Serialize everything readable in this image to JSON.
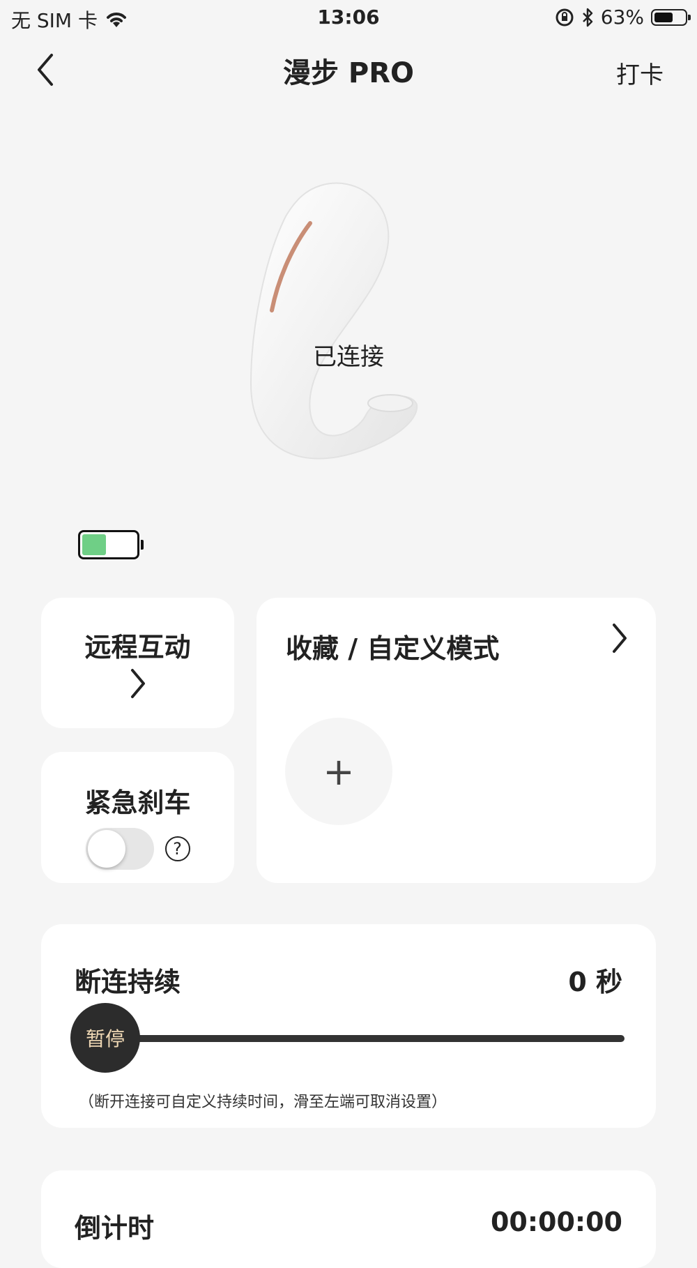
{
  "status_bar": {
    "carrier": "无 SIM 卡",
    "time": "13:06",
    "battery_percent": "63%",
    "battery_level": 0.63,
    "icons": [
      "wifi-icon",
      "orientation-lock-icon",
      "bluetooth-icon",
      "battery-icon"
    ]
  },
  "nav": {
    "title": "漫步 PRO",
    "action_label": "打卡",
    "back_icon": "chevron-left-icon"
  },
  "device": {
    "status": "已连接",
    "battery_level": 0.45,
    "battery_color": "#6fcf86"
  },
  "cards": {
    "remote": {
      "label": "远程互动"
    },
    "favorites": {
      "label": "收藏 / 自定义模式",
      "add_symbol": "+"
    },
    "brake": {
      "label": "紧急刹车",
      "toggle_on": false,
      "help_symbol": "?"
    },
    "duration": {
      "label": "断连持续",
      "value": "0 秒",
      "slider_thumb_label": "暂停",
      "slider_value": 0,
      "hint": "（断开连接可自定义持续时间，滑至左端可取消设置）"
    },
    "countdown": {
      "label": "倒计时",
      "value": "00:00:00"
    }
  }
}
